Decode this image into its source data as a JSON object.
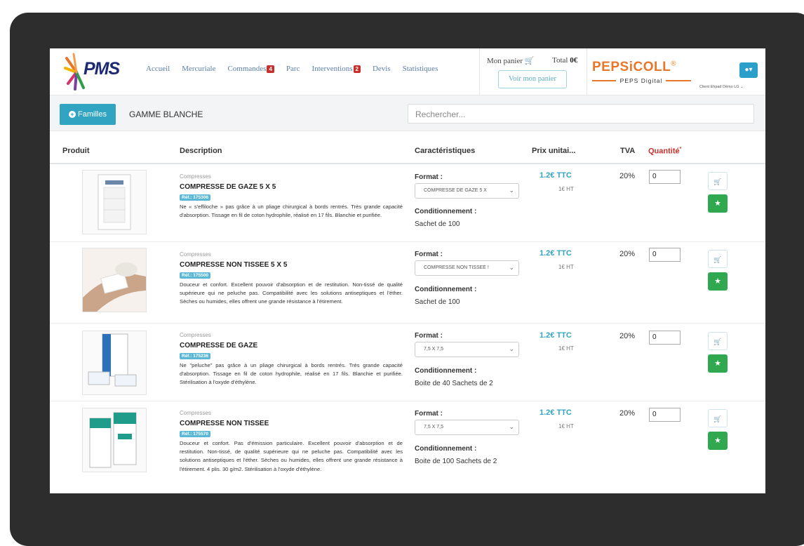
{
  "nav": {
    "logo": "PMS",
    "links": [
      {
        "label": "Accueil",
        "badge": null
      },
      {
        "label": "Mercuriale",
        "badge": null
      },
      {
        "label": "Commandes",
        "badge": "4"
      },
      {
        "label": "Parc",
        "badge": null
      },
      {
        "label": "Interventions",
        "badge": "2"
      },
      {
        "label": "Devis",
        "badge": null
      },
      {
        "label": "Statistiques",
        "badge": null
      }
    ],
    "cart_label": "Mon panier",
    "total_label": "Total",
    "total_value": "0€",
    "cart_button": "Voir mon panier",
    "peps_logo": "PEPSiCOLL",
    "peps_mark": "®",
    "peps_sub": "PEPS Digital",
    "client": "Client Ehpad Démo LG"
  },
  "toolbar": {
    "families_button": "Familles",
    "gamme": "GAMME BLANCHE",
    "search_placeholder": "Rechercher..."
  },
  "table": {
    "headers": {
      "produit": "Produit",
      "description": "Description",
      "caracteristiques": "Caractéristiques",
      "prix": "Prix unitai...",
      "tva": "TVA",
      "quantite": "Quantité",
      "required": "*"
    },
    "format_label": "Format :",
    "cond_label": "Conditionnement :",
    "rows": [
      {
        "category": "Compresses",
        "name": "COMPRESSE DE GAZE 5 X 5",
        "ref": "Réf.: 175306",
        "description": "Ne « s'effiloche » pas grâce à un pliage chirurgical à bords rentrés. Très grande capacité d'absorption. Tissage en fil de coton hydrophile, réalisé en 17 fils. Blanchie et purifiée.",
        "format": "COMPRESSE DE GAZE 5 X",
        "conditionnement": "Sachet de 100",
        "price_ttc": "1.2€ TTC",
        "price_ht": "1€ HT",
        "tva": "20%",
        "qty": "0"
      },
      {
        "category": "Compresses",
        "name": "COMPRESSE NON TISSEE 5 X 5",
        "ref": "Réf.: 175500",
        "description": "Douceur et confort. Excellent pouvoir d'absorption et de restitution. Non-tissé de qualité supérieure qui ne peluche pas. Compatibilité avec les solutions antiseptiques et l'éther. Sèches ou humides, elles offrent une grande résistance à l'étirement.",
        "format": "COMPRESSE NON TISSEE !",
        "conditionnement": "Sachet de 100",
        "price_ttc": "1.2€ TTC",
        "price_ht": "1€ HT",
        "tva": "20%",
        "qty": "0"
      },
      {
        "category": "Compresses",
        "name": "COMPRESSE DE GAZE",
        "ref": "Réf.: 175236",
        "description": "Ne \"peluche\" pas grâce à un pliage chirurgical à bords rentrés. Très grande capacité d'absorption. Tissage en fil de coton hydrophile, réalisé en 17 fils. Blanchie et purifiée. Stérilisation à l'oxyde d'éthylène.",
        "format": "7,5 X 7,5",
        "conditionnement": "Boite de 40 Sachets de 2",
        "price_ttc": "1.2€ TTC",
        "price_ht": "1€ HT",
        "tva": "20%",
        "qty": "0"
      },
      {
        "category": "Compresses",
        "name": "COMPRESSE NON TISSEE",
        "ref": "Réf.: 175570",
        "description": "Douceur et confort. Pas d'émission particulaire. Excellent pouvoir d'absorption et de restitution. Non-tissé, de qualité supérieure qui ne peluche pas. Compatibilité avec les solutions antiseptiques et l'éther. Sèches ou humides, elles offrent une grande résistance à l'étirement. 4 plis. 30 g/m2. Stérilisation à l'oxyde d'éthylène.",
        "format": "7,5 X 7,5",
        "conditionnement": "Boite de 100 Sachets de 2",
        "price_ttc": "1.2€ TTC",
        "price_ht": "1€ HT",
        "tva": "20%",
        "qty": "0"
      }
    ]
  }
}
